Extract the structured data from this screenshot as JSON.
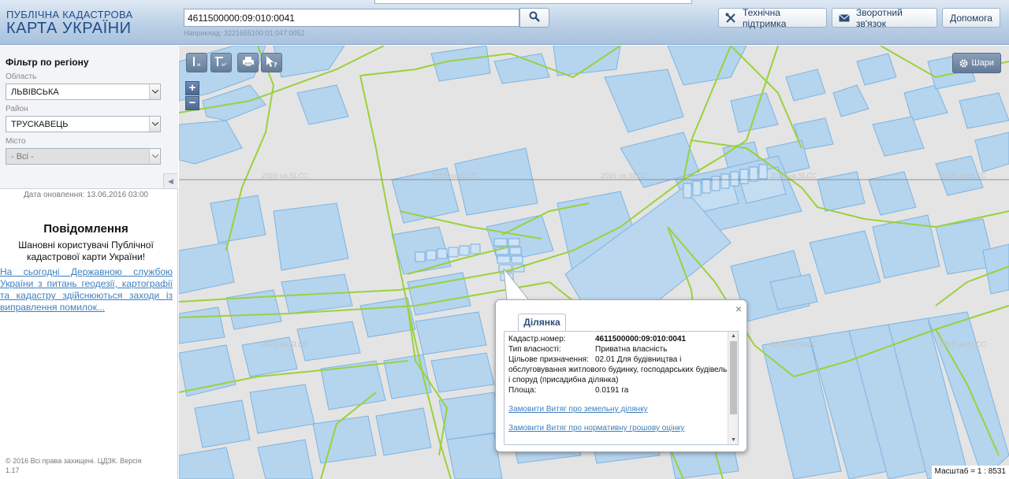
{
  "header": {
    "logo_top": "ПУБЛІЧНА КАДАСТРОВА",
    "logo_bottom": "КАРТА УКРАЇНИ",
    "search_value": "4611500000:09:010:0041",
    "search_example": "Наприклад: 3221655100:01:047:0052",
    "support_label": "Технічна підтримка",
    "feedback_label": "Зворотний зв'язок",
    "help_label": "Допомога",
    "accent_color": "#1f4e89"
  },
  "sidebar": {
    "filter_title": "Фільтр по регіону",
    "region_label": "Область",
    "region_value": "ЛЬВІВСЬКА",
    "district_label": "Район",
    "district_value": "ТРУСКАВЕЦЬ",
    "city_label": "Місто",
    "city_value": "- Всі -",
    "update_date": "Дата оновлення: 13.06.2016 03:00",
    "notice_title": "Повідомлення",
    "notice_text": "Шановні користувачі Публічної кадастрової карти України!",
    "notice_link": "На сьогодні Державною службою України з питань геодезії, картографії та кадастру здійснюються заходи із виправлення помилок...",
    "copyright": "© 2016 Всі права захищені. ЦДЗК. Версія 1.17"
  },
  "map": {
    "layers_label": "Шари",
    "zoom_in": "+",
    "zoom_out": "−",
    "scale_text": "Масштаб = 1 : 8531",
    "watermark": "2016 ua.SLCC",
    "parcel_fill": "#b3d4ef",
    "parcel_stroke": "#79b2e0",
    "boundary_color": "#9ad13c"
  },
  "popup": {
    "tab_label": "Ділянка",
    "close_symbol": "×",
    "rows": [
      {
        "key": "Кадастр.номер:",
        "value": "4611500000:09:010:0041"
      },
      {
        "key": "Тип власності:",
        "value": "Приватна власність"
      },
      {
        "key": "Цільове призначення:",
        "value": "02.01 Для будівництва і обслуговування житлового будинку, господарських будівель і споруд (присадибна ділянка)"
      },
      {
        "key": "Площа:",
        "value": "0.0191 га"
      }
    ],
    "link_extract": "Замовити Витяг про земельну ділянку",
    "link_valuation": "Замовити Витяг про нормативну грошову оцінку"
  }
}
